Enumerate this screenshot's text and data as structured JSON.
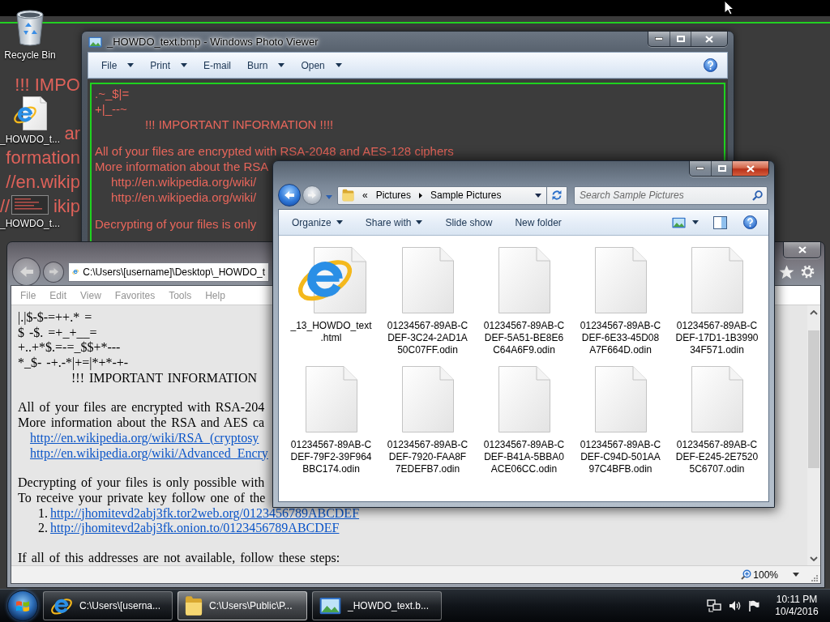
{
  "wallpaper": {
    "paragraphs": [
      [
        [
          "!!! IMPO"
        ]
      ],
      [
        [
          "ar"
        ],
        [
          "formation"
        ],
        [
          "//en.wikip"
        ],
        [
          "//",
          "ikip"
        ]
      ]
    ]
  },
  "desktop_icons": [
    {
      "label": "Recycle Bin",
      "kind": "recycle-bin"
    },
    {
      "label": "_HOWDO_t...",
      "kind": "html"
    },
    {
      "label": "_HOWDO_t...",
      "kind": "image"
    }
  ],
  "photo_viewer": {
    "title": "_HOWDO_text.bmp - Windows Photo Viewer",
    "menu": [
      {
        "label": "File",
        "has_menu": true
      },
      {
        "label": "Print",
        "has_menu": true
      },
      {
        "label": "E-mail",
        "has_menu": false
      },
      {
        "label": "Burn",
        "has_menu": true
      },
      {
        "label": "Open",
        "has_menu": true
      }
    ],
    "image_text": [
      [
        {
          "kind": "plain",
          "text": ".~_$|="
        },
        {
          "kind": "plain",
          "text": "+|_--~"
        },
        {
          "kind": "heading",
          "text": "!!! IMPORTANT INFORMATION !!!!"
        }
      ],
      [
        {
          "kind": "plain",
          "text": "All of your files are encrypted with RSA-2048 and AES-128 ciphers"
        },
        {
          "kind": "plain",
          "text": "More information about the RSA"
        },
        {
          "kind": "indent",
          "text": "http://en.wikipedia.org/wiki/"
        },
        {
          "kind": "indent",
          "text": "http://en.wikipedia.org/wiki/"
        }
      ],
      [
        {
          "kind": "plain",
          "text": "Decrypting of your files is only"
        }
      ]
    ]
  },
  "explorer": {
    "path_overflow": "«",
    "breadcrumb": [
      "Pictures",
      "Sample Pictures"
    ],
    "search": {
      "placeholder": "Search Sample Pictures"
    },
    "toolbar": [
      {
        "label": "Organize",
        "has_menu": true
      },
      {
        "label": "Share with",
        "has_menu": true
      },
      {
        "label": "Slide show",
        "has_menu": false
      },
      {
        "label": "New folder",
        "has_menu": false
      }
    ],
    "files": [
      {
        "kind": "html",
        "lines": [
          "_13_HOWDO_text",
          ".html"
        ]
      },
      {
        "kind": "blank",
        "lines": [
          "01234567-89AB-C",
          "DEF-3C24-2AD1A",
          "50C07FF.odin"
        ]
      },
      {
        "kind": "blank",
        "lines": [
          "01234567-89AB-C",
          "DEF-5A51-BE8E6",
          "C64A6F9.odin"
        ]
      },
      {
        "kind": "blank",
        "lines": [
          "01234567-89AB-C",
          "DEF-6E33-45D08",
          "A7F664D.odin"
        ]
      },
      {
        "kind": "blank",
        "lines": [
          "01234567-89AB-C",
          "DEF-17D1-1B3990",
          "34F571.odin"
        ]
      },
      {
        "kind": "blank",
        "lines": [
          "01234567-89AB-C",
          "DEF-79F2-39F964",
          "BBC174.odin"
        ]
      },
      {
        "kind": "blank",
        "lines": [
          "01234567-89AB-C",
          "DEF-7920-FAA8F",
          "7EDEFB7.odin"
        ]
      },
      {
        "kind": "blank",
        "lines": [
          "01234567-89AB-C",
          "DEF-B41A-5BBA0",
          "ACE06CC.odin"
        ]
      },
      {
        "kind": "blank",
        "lines": [
          "01234567-89AB-C",
          "DEF-C94D-501AA",
          "97C4BFB.odin"
        ]
      },
      {
        "kind": "blank",
        "lines": [
          "01234567-89AB-C",
          "DEF-E245-2E7520",
          "5C6707.odin"
        ]
      }
    ]
  },
  "browser": {
    "address": "C:\\Users\\[username]\\Desktop\\_HOWDO_t",
    "menu": [
      "File",
      "Edit",
      "View",
      "Favorites",
      "Tools",
      "Help"
    ],
    "page": [
      [
        {
          "kind": "plain",
          "text": "|.|$-$-=++.* ="
        },
        {
          "kind": "plain",
          "text": "$ -$. =+_+__="
        },
        {
          "kind": "plain",
          "text": "+..+*$.=-=_$$+*---"
        },
        {
          "kind": "plain",
          "text": "*_$- -+.-*|+=|*+*-+-"
        },
        {
          "kind": "heading",
          "text": "!!! IMPORTANT INFORMATION"
        }
      ],
      [
        {
          "kind": "plain",
          "text": "All of your files are encrypted with RSA-204"
        },
        {
          "kind": "plain",
          "text": "More information about the RSA and AES ca"
        },
        {
          "kind": "link",
          "text": "http://en.wikipedia.org/wiki/RSA_(cryptosy"
        },
        {
          "kind": "link",
          "text": "http://en.wikipedia.org/wiki/Advanced_Encry"
        }
      ],
      [
        {
          "kind": "plain",
          "text": "Decrypting of your files is only possible with"
        },
        {
          "kind": "plain",
          "text": "To receive your private key follow one of the"
        },
        {
          "kind": "numbered",
          "number": "1.",
          "text": "http://jhomitevd2abj3fk.tor2web.org/0123456789ABCDEF"
        },
        {
          "kind": "numbered",
          "number": "2.",
          "text": "http://jhomitevd2abj3fk.onion.to/0123456789ABCDEF"
        }
      ],
      [
        {
          "kind": "plain",
          "text": "If all of this addresses are not available, follow these steps:"
        }
      ]
    ],
    "zoom": "100%"
  },
  "taskbar": {
    "buttons": [
      {
        "kind": "browser",
        "label": "C:\\Users\\[userna...",
        "selected": false
      },
      {
        "kind": "folder",
        "label": "C:\\Users\\Public\\P...",
        "selected": true
      },
      {
        "kind": "photo",
        "label": "_HOWDO_text.b...",
        "selected": false
      }
    ],
    "time": "10:11 PM",
    "date": "10/4/2016"
  }
}
